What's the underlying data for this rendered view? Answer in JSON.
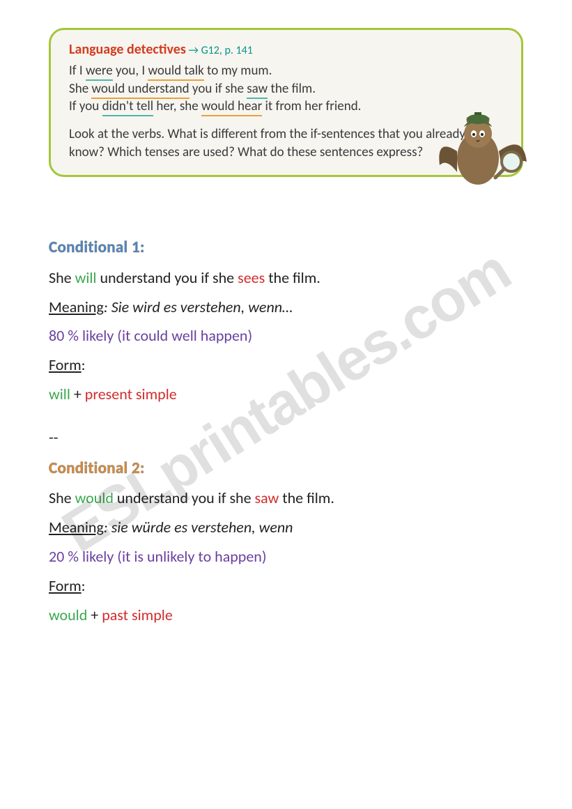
{
  "watermark": "ESLprintables.com",
  "textbook": {
    "title": "Language detectives",
    "reference": "→ G12, p. 141",
    "sentences": {
      "s1": {
        "pre": "If I ",
        "u1": "were",
        "mid1": " you, I ",
        "u2": "would talk",
        "post": " to my mum."
      },
      "s2": {
        "pre": "She ",
        "u1": "would understand",
        "mid1": " you if she ",
        "u2": "saw",
        "post": " the film."
      },
      "s3": {
        "pre": "If you ",
        "u1": "didn't tell",
        "mid1": " her, she ",
        "u2": "would hear",
        "post": " it from her friend."
      }
    },
    "question": "Look at the verbs. What is different from the if-sentences that you already know? Which tenses are used? What do these sentences express?"
  },
  "cond1": {
    "heading": "Conditional 1:",
    "example": {
      "pre": "She ",
      "aux": "will",
      "mid": " understand you if she ",
      "verb": "sees",
      "post": " the film."
    },
    "meaning_label": "Meaning",
    "meaning_text": ": Sie wird es verstehen, wenn…",
    "likelihood": "80 % likely (it could well happen)",
    "form_label": "Form",
    "form": {
      "aux": "will",
      "sep": " + ",
      "tense": "present simple"
    }
  },
  "separator": "--",
  "cond2": {
    "heading": "Conditional 2:",
    "example": {
      "pre": "She ",
      "aux": "would",
      "mid": " understand you if she ",
      "verb": "saw",
      "post": " the film."
    },
    "meaning_label": "Meaning",
    "meaning_text": ": sie würde es verstehen, wenn",
    "likelihood": "20 % likely (it is unlikely to happen)",
    "form_label": "Form",
    "form": {
      "aux": "would",
      "sep": " + ",
      "tense": "past simple"
    }
  }
}
